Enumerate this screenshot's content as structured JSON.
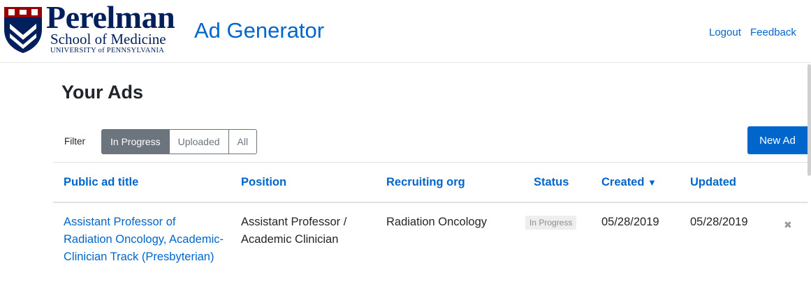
{
  "header": {
    "logo": {
      "name": "Perelman",
      "school": "School of Medicine",
      "university": "UNIVERSITY of PENNSYLVANIA"
    },
    "app_title": "Ad Generator",
    "nav": {
      "logout": "Logout",
      "feedback": "Feedback"
    }
  },
  "page": {
    "heading": "Your Ads"
  },
  "filter": {
    "label": "Filter",
    "options": [
      "In Progress",
      "Uploaded",
      "All"
    ],
    "selected": "In Progress"
  },
  "new_ad_button": "New Ad",
  "table": {
    "columns": {
      "title": "Public ad title",
      "position": "Position",
      "org": "Recruiting org",
      "status": "Status",
      "created": "Created",
      "created_sort": "▼",
      "updated": "Updated"
    },
    "rows": [
      {
        "title": "Assistant Professor of Radiation Oncology, Academic-Clinician Track (Presbyterian)",
        "position": "Assistant Professor  /  Academic Clinician",
        "org": "Radiation Oncology",
        "status": "In Progress",
        "created": "05/28/2019",
        "updated": "05/28/2019"
      }
    ]
  },
  "colors": {
    "link": "#0066cc",
    "penn_navy": "#011f5b",
    "penn_red": "#990000",
    "filter_active": "#6c757d",
    "primary_button": "#0066cc"
  },
  "icons": {
    "row_delete": "close-icon",
    "logo": "penn-shield-icon"
  }
}
